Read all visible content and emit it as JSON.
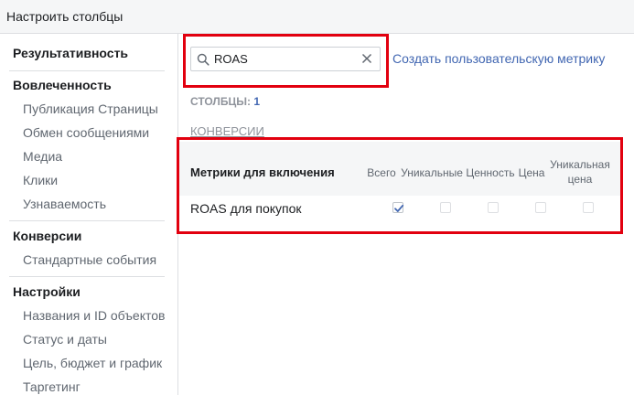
{
  "header": {
    "title": "Настроить столбцы"
  },
  "sidebar": {
    "sections": [
      {
        "label": "Результативность",
        "items": []
      },
      {
        "label": "Вовлеченность",
        "items": [
          "Публикация Страницы",
          "Обмен сообщениями",
          "Медиа",
          "Клики",
          "Узнаваемость"
        ]
      },
      {
        "label": "Конверсии",
        "items": [
          "Стандартные события"
        ]
      },
      {
        "label": "Настройки",
        "items": [
          "Названия и ID объектов",
          "Статус и даты",
          "Цель, бюджет и график",
          "Таргетинг"
        ]
      }
    ]
  },
  "search": {
    "value": "ROAS",
    "icon": "search-icon",
    "clear_icon": "close-icon"
  },
  "create_metric_link": "Создать пользовательскую метрику",
  "columns_label": "СТОЛБЦЫ:",
  "columns_count": "1",
  "category_label": "КОНВЕРСИИ",
  "table": {
    "title": "Метрики для включения",
    "columns": [
      "Всего",
      "Уникальные",
      "Ценность",
      "Цена",
      "Уникальная цена"
    ],
    "rows": [
      {
        "label": "ROAS для покупок",
        "checked": [
          true,
          false,
          false,
          false,
          false
        ]
      }
    ]
  },
  "colors": {
    "highlight": "#e2000f",
    "link": "#4267b2",
    "check": "#4267b2"
  }
}
